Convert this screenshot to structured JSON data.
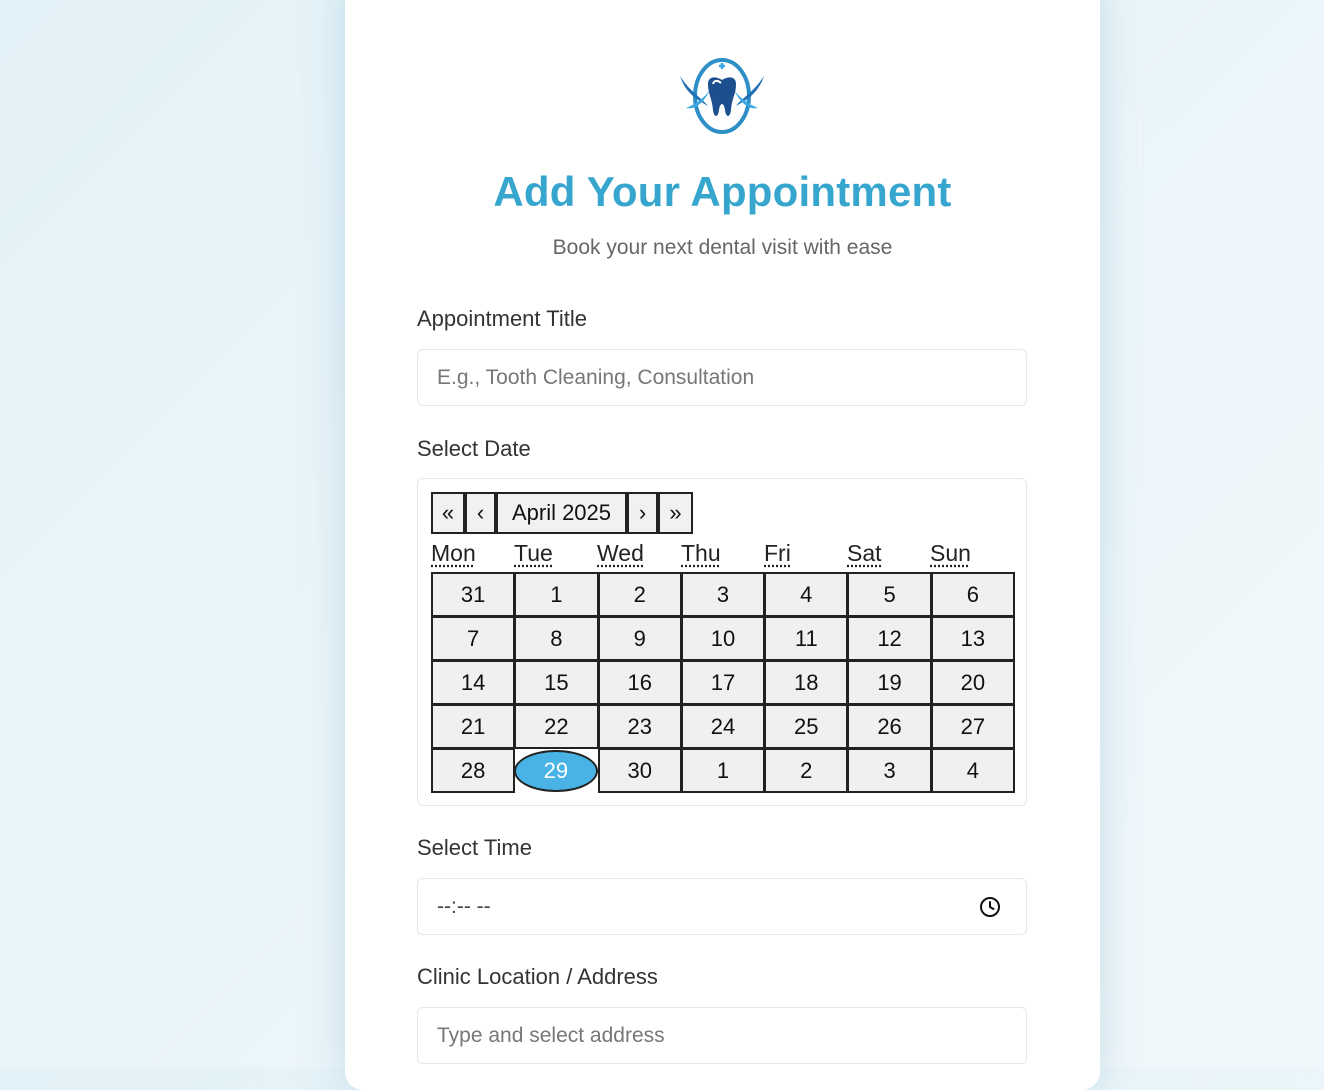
{
  "header": {
    "title": "Add Your Appointment",
    "subtitle": "Book your next dental visit with ease",
    "logo_icon": "tooth-logo-icon"
  },
  "form": {
    "appointment_title_label": "Appointment Title",
    "appointment_title_placeholder": "E.g., Tooth Cleaning, Consultation",
    "appointment_title_value": "",
    "date_label": "Select Date",
    "time_label": "Select Time",
    "time_value": "--:-- --",
    "location_label": "Clinic Location / Address",
    "location_placeholder": "Type and select address",
    "location_value": ""
  },
  "calendar": {
    "nav": {
      "prev_year": "«",
      "prev_month": "‹",
      "month_label": "April 2025",
      "next_month": "›",
      "next_year": "»"
    },
    "weekdays": [
      "Mon",
      "Tue",
      "Wed",
      "Thu",
      "Fri",
      "Sat",
      "Sun"
    ],
    "weeks": [
      [
        "31",
        "1",
        "2",
        "3",
        "4",
        "5",
        "6"
      ],
      [
        "7",
        "8",
        "9",
        "10",
        "11",
        "12",
        "13"
      ],
      [
        "14",
        "15",
        "16",
        "17",
        "18",
        "19",
        "20"
      ],
      [
        "21",
        "22",
        "23",
        "24",
        "25",
        "26",
        "27"
      ],
      [
        "28",
        "29",
        "30",
        "1",
        "2",
        "3",
        "4"
      ]
    ],
    "selected_day": "29"
  },
  "colors": {
    "accent": "#36a6cf",
    "selected_day": "#4ab3e6"
  }
}
